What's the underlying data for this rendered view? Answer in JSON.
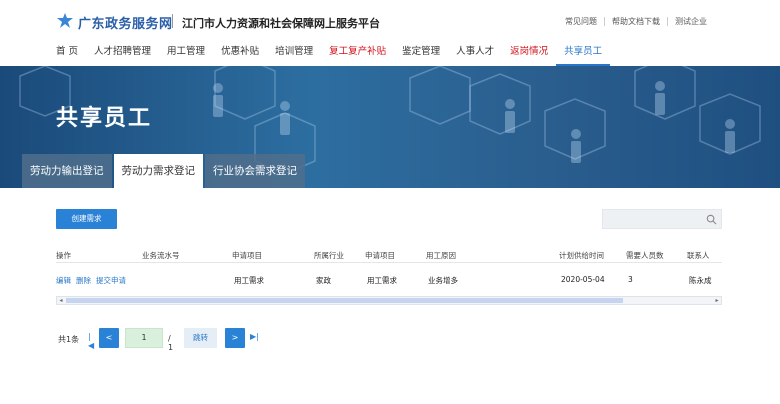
{
  "header": {
    "brand": "广东政务服务网",
    "subtitle": "江门市人力资源和社会保障网上服务平台",
    "links": [
      "常见问题",
      "帮助文档下载",
      "测试企业"
    ]
  },
  "nav": {
    "items": [
      {
        "label": "首 页",
        "color": "default"
      },
      {
        "label": "人才招聘管理",
        "color": "default"
      },
      {
        "label": "用工管理",
        "color": "default"
      },
      {
        "label": "优惠补贴",
        "color": "default"
      },
      {
        "label": "培训管理",
        "color": "default"
      },
      {
        "label": "复工复产补贴",
        "color": "red"
      },
      {
        "label": "鉴定管理",
        "color": "default"
      },
      {
        "label": "人事人才",
        "color": "default"
      },
      {
        "label": "返岗情况",
        "color": "red"
      },
      {
        "label": "共享员工",
        "color": "active"
      }
    ]
  },
  "banner": {
    "title": "共享员工"
  },
  "tabs": [
    {
      "label": "劳动力输出登记",
      "active": false
    },
    {
      "label": "劳动力需求登记",
      "active": true
    },
    {
      "label": "行业协会需求登记",
      "active": false
    }
  ],
  "toolbar": {
    "create_label": "创建需求",
    "search_placeholder": ""
  },
  "table": {
    "columns": [
      "操作",
      "业务流水号",
      "申请项目",
      "所属行业",
      "申请项目",
      "用工原因",
      "计划供给时间",
      "需要人员数",
      "联系人"
    ],
    "rows": [
      {
        "actions": [
          "编辑",
          "删除",
          "提交申请"
        ],
        "serial": "",
        "project": "用工需求",
        "industry": "家政",
        "project2": "用工需求",
        "reason": "业务增多",
        "date": "2020-05-04",
        "count": "3",
        "contact": "陈永成"
      }
    ]
  },
  "pager": {
    "total": "共1条",
    "first": "|◀",
    "prev": "<",
    "current": "1",
    "of": "/ 1",
    "jump": "跳转",
    "next": ">",
    "last": "▶|"
  },
  "colors": {
    "brand": "#2a5ea8",
    "accent": "#2a82d6",
    "red": "#d0121b",
    "banner": "#2d6ea0"
  }
}
